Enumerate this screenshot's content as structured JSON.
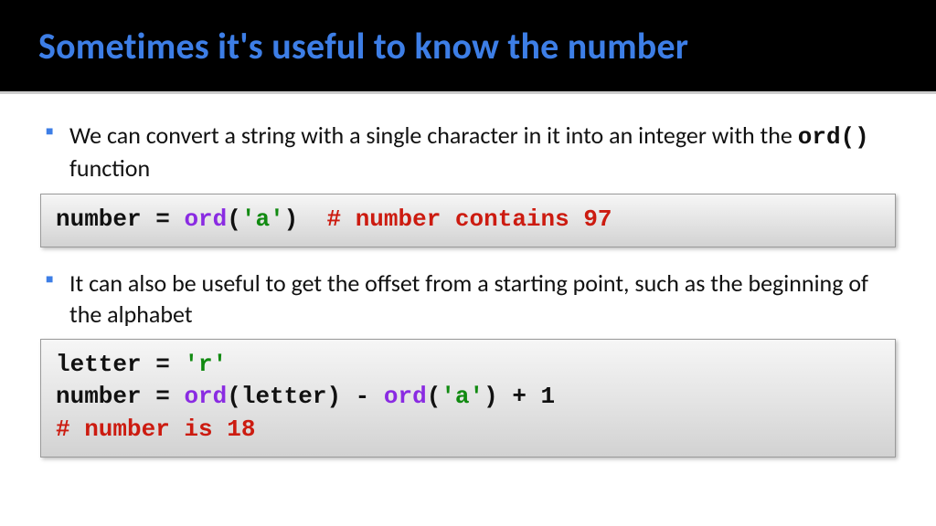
{
  "title": "Sometimes it's useful to know the number",
  "bullets": [
    {
      "pre": "We can convert a string with a single character in it into an integer with the ",
      "code": "ord()",
      "post": "  function"
    },
    {
      "pre": "It can also be useful to get the offset from a starting point, such as the beginning of the alphabet",
      "code": "",
      "post": ""
    }
  ],
  "code1": {
    "l1_a": "number = ",
    "l1_fn": "ord",
    "l1_p1": "(",
    "l1_str": "'a'",
    "l1_p2": ")  ",
    "l1_cmt": "# number contains 97"
  },
  "code2": {
    "l1_a": "letter = ",
    "l1_str": "'r'",
    "l2_a": "number = ",
    "l2_fn1": "ord",
    "l2_p1": "(letter) - ",
    "l2_fn2": "ord",
    "l2_p2": "(",
    "l2_str": "'a'",
    "l2_p3": ") + 1",
    "l3_cmt": "# number is 18"
  }
}
